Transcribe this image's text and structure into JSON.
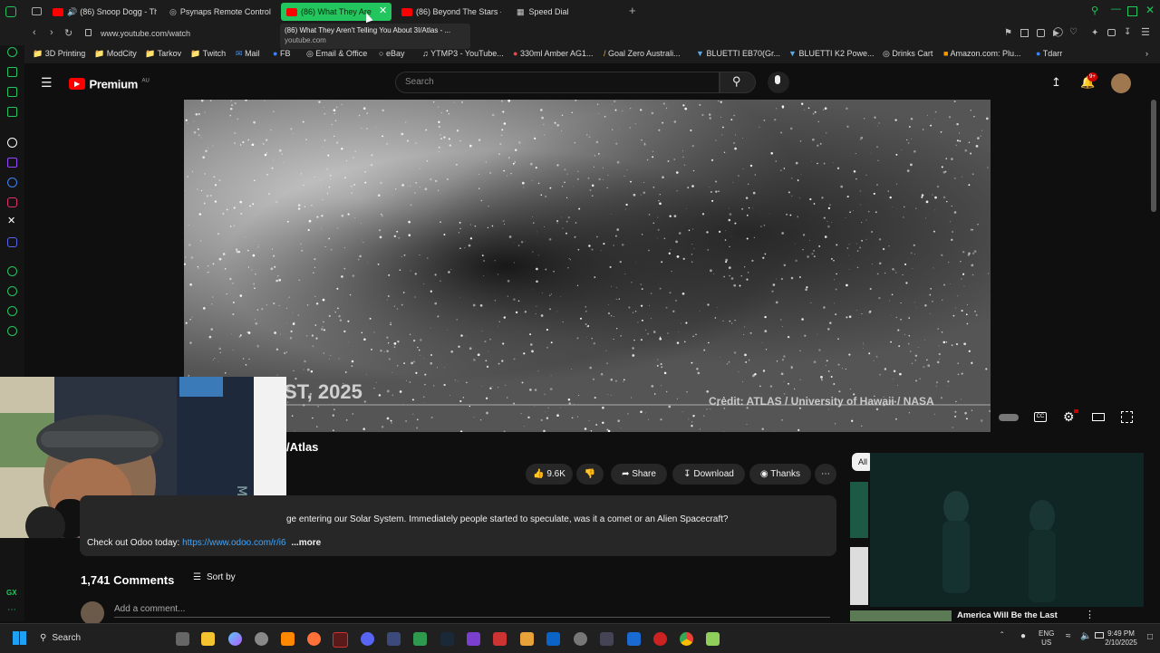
{
  "browser": {
    "tabs": [
      {
        "title": "(86) Snoop Dogg - Th",
        "icon": "youtube-icon"
      },
      {
        "title": "Psynaps Remote Control",
        "icon": "globe-icon"
      },
      {
        "title": "(86) What They Are",
        "icon": "youtube-icon"
      },
      {
        "title": "(86) Beyond The Stars -",
        "icon": "youtube-icon"
      },
      {
        "title": "Speed Dial",
        "icon": "grid-icon"
      }
    ],
    "tooltip_title": "(86) What They Aren't Telling You About 3I/Atlas - ...",
    "tooltip_url": "youtube.com",
    "url": "www.youtube.com/watch",
    "bookmarks": [
      "3D Printing",
      "ModCity",
      "Tarkov",
      "Twitch",
      "Mail",
      "FB",
      "Email & Office",
      "eBay",
      "YTMP3 - YouTube...",
      "330ml Amber AG1...",
      "Goal Zero Australi...",
      "BLUETTI EB70(Gr...",
      "BLUETTI K2 Powe...",
      "Drinks Cart",
      "Amazon.com: Plu...",
      "Tdarr"
    ]
  },
  "youtube": {
    "logo_text": "Premium",
    "region": "AU",
    "search_placeholder": "Search",
    "notification_count": "9+",
    "video": {
      "overlay_date": "ST, 2025",
      "credit": "Credit: ATLAS / University of Hawaii / NASA"
    },
    "title_fragment": "/Atlas",
    "actions": {
      "likes": "9.6K",
      "share": "Share",
      "download": "Download",
      "thanks": "Thanks"
    },
    "description": "ge entering our Solar System. Immediately people started to speculate, was it a comet or an Alien Spacecraft?",
    "desc_link_prefix": "Check out Odoo today:",
    "desc_link": "https://www.odoo.com/r/i6",
    "desc_more": "...more",
    "comments_count": "1,741 Comments",
    "sort_by": "Sort by",
    "add_comment": "Add a comment...",
    "chip_all": "All",
    "side_video_title": "America Will Be the Last"
  },
  "taskbar": {
    "search": "Search",
    "lang_top": "ENG",
    "lang_bottom": "US",
    "time": "9:49 PM",
    "date": "2/10/2025"
  },
  "colors": {
    "accent": "#22c55e",
    "youtube_red": "#ff0000",
    "link": "#3ea6ff"
  }
}
